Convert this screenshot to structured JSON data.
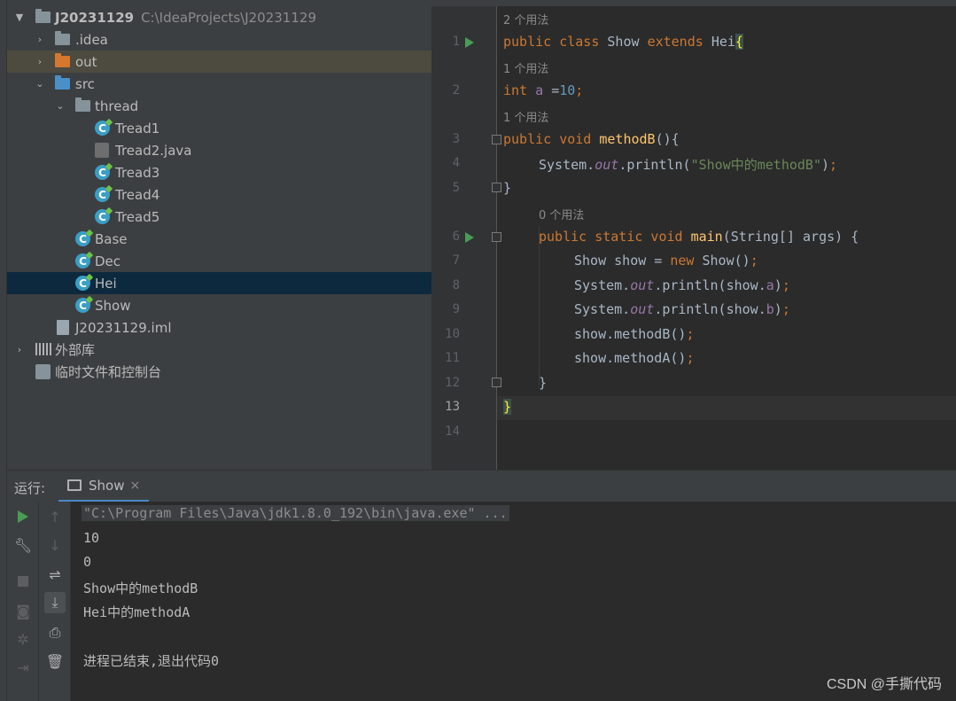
{
  "project_tree": {
    "root": {
      "name": "J20231129",
      "path": "C:\\IdeaProjects\\J20231129"
    },
    "items": [
      {
        "label": ".idea"
      },
      {
        "label": "out"
      },
      {
        "label": "src"
      },
      {
        "label": "thread"
      },
      {
        "label": "Tread1"
      },
      {
        "label": "Tread2.java"
      },
      {
        "label": "Tread3"
      },
      {
        "label": "Tread4"
      },
      {
        "label": "Tread5"
      },
      {
        "label": "Base"
      },
      {
        "label": "Dec"
      },
      {
        "label": "Hei"
      },
      {
        "label": "Show"
      },
      {
        "label": "J20231129.iml"
      },
      {
        "label": "外部库"
      },
      {
        "label": "临时文件和控制台"
      }
    ],
    "class_icon_letter": "C"
  },
  "editor": {
    "line_numbers": [
      "1",
      "2",
      "3",
      "4",
      "5",
      "6",
      "7",
      "8",
      "9",
      "10",
      "11",
      "12",
      "13",
      "14"
    ],
    "hints": [
      "2 个用法",
      "1 个用法",
      "1 个用法",
      "0 个用法"
    ],
    "code": {
      "l1": {
        "kw1": "public class ",
        "name": "Show ",
        "kw2": "extends ",
        "sup": "Hei",
        "brace": "{"
      },
      "l2": {
        "kw": "int ",
        "field": "a ",
        "eq": "=",
        "num": "10",
        "semi": ";"
      },
      "l3": {
        "kw": "public void ",
        "fn": "methodB",
        "rest": "(){"
      },
      "l4": {
        "a": "System.",
        "out": "out",
        "b": ".println(",
        "str": "\"Show中的methodB\"",
        "c": ")",
        "semi": ";"
      },
      "l5": {
        "text": "}"
      },
      "l6": {
        "kw": "public static void ",
        "fn": "main",
        "rest": "(String[] args) {"
      },
      "l7": {
        "a": "Show show = ",
        "kw": "new ",
        "b": "Show()",
        "semi": ";"
      },
      "l8": {
        "a": "System.",
        "out": "out",
        "b": ".println(show.",
        "f": "a",
        "c": ")",
        "semi": ";"
      },
      "l9": {
        "a": "System.",
        "out": "out",
        "b": ".println(show.",
        "f": "b",
        "c": ")",
        "semi": ";"
      },
      "l10": {
        "a": "show.methodB()",
        "semi": ";"
      },
      "l11": {
        "a": "show.methodA()",
        "semi": ";"
      },
      "l12": {
        "text": "}"
      },
      "l13": {
        "text": "}"
      }
    },
    "current_line": "13"
  },
  "run_panel": {
    "title": "运行:",
    "tab_label": "Show",
    "tab_close": "×",
    "output": [
      "\"C:\\Program Files\\Java\\jdk1.8.0_192\\bin\\java.exe\" ...",
      "10",
      "0",
      "Show中的methodB",
      "Hei中的methodA",
      "",
      "进程已结束,退出代码0"
    ]
  },
  "watermark": "CSDN @手撕代码",
  "colors": {
    "background": "#2b2b2b",
    "panel": "#3c3f41",
    "keyword": "#cc7832",
    "function": "#ffc66d",
    "string": "#6a8759",
    "number": "#6897bb",
    "field": "#9876aa",
    "selection": "#0d293e",
    "run_green": "#499c54"
  }
}
